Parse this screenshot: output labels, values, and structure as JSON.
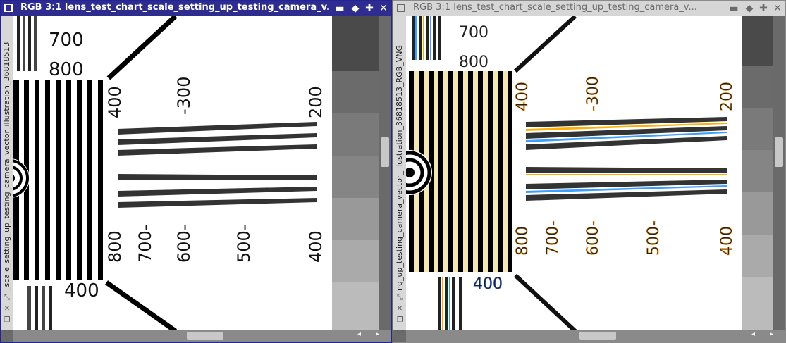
{
  "left_window": {
    "title": "RGB 3:1 lens_test_chart_scale_setting_up_testing_camera_v...",
    "side_label": "_scale_setting_up_testing_camera_vector_illustration_36818513",
    "buttons": {
      "minimize": "▬",
      "maximize": "◆",
      "pin": "✚",
      "close": "✕"
    }
  },
  "right_window": {
    "title": "RGB 3:1 lens_test_chart_scale_setting_up_testing_camera_v...",
    "side_label": "ng_up_testing_camera_vector_illustration_36818513_RGB_VNG",
    "buttons": {
      "minimize": "▬",
      "maximize": "◆",
      "pin": "✚",
      "close": "✕"
    }
  },
  "chart_labels": {
    "top_700": "700",
    "top_800": "800",
    "top_400": "400",
    "top_300": "-300",
    "top_200": "200",
    "bottom_800": "800",
    "bottom_700": "700-",
    "bottom_600": "600-",
    "bottom_500": "500-",
    "bottom_400": "400",
    "lower_400": "400"
  },
  "icons": {
    "side_1": "side-zoom-icon",
    "side_2": "side-fit-icon",
    "side_3": "side-copy-icon",
    "side_4": "side-page-icon",
    "scroll_left": "◂",
    "scroll_right": "▸"
  },
  "colors": {
    "active_titlebar": "#2f2c8f",
    "inactive_titlebar": "#d6d6d6",
    "chart_bg": "#ffffff",
    "stripe": "#000000"
  }
}
